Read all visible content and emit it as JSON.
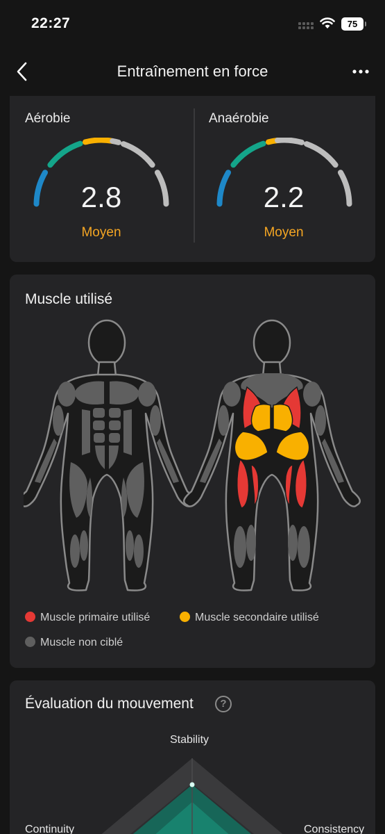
{
  "status_bar": {
    "time": "22:27",
    "battery": "75"
  },
  "header": {
    "title": "Entraînement en force"
  },
  "training_effect": {
    "aerobic": {
      "label": "Aérobie",
      "value": "2.8",
      "level": "Moyen"
    },
    "anaerobic": {
      "label": "Anaérobie",
      "value": "2.2",
      "level": "Moyen"
    }
  },
  "muscles": {
    "title": "Muscle utilisé",
    "legend": {
      "primary": "Muscle primaire utilisé",
      "secondary": "Muscle secondaire utilisé",
      "untargeted": "Muscle non ciblé"
    }
  },
  "movement_evaluation": {
    "title": "Évaluation du mouvement",
    "axes": {
      "top": "Stability",
      "left": "Continuity",
      "right": "Consistency"
    }
  },
  "colors": {
    "primary_muscle": "#e53935",
    "secondary_muscle": "#f9b000",
    "untargeted_muscle": "#5f5f5f",
    "level_text": "#f5a623",
    "gauge_blue": "#1e88c8",
    "gauge_green": "#14a58a",
    "gauge_orange": "#f9b000",
    "gauge_gray": "#bdbdbd"
  }
}
